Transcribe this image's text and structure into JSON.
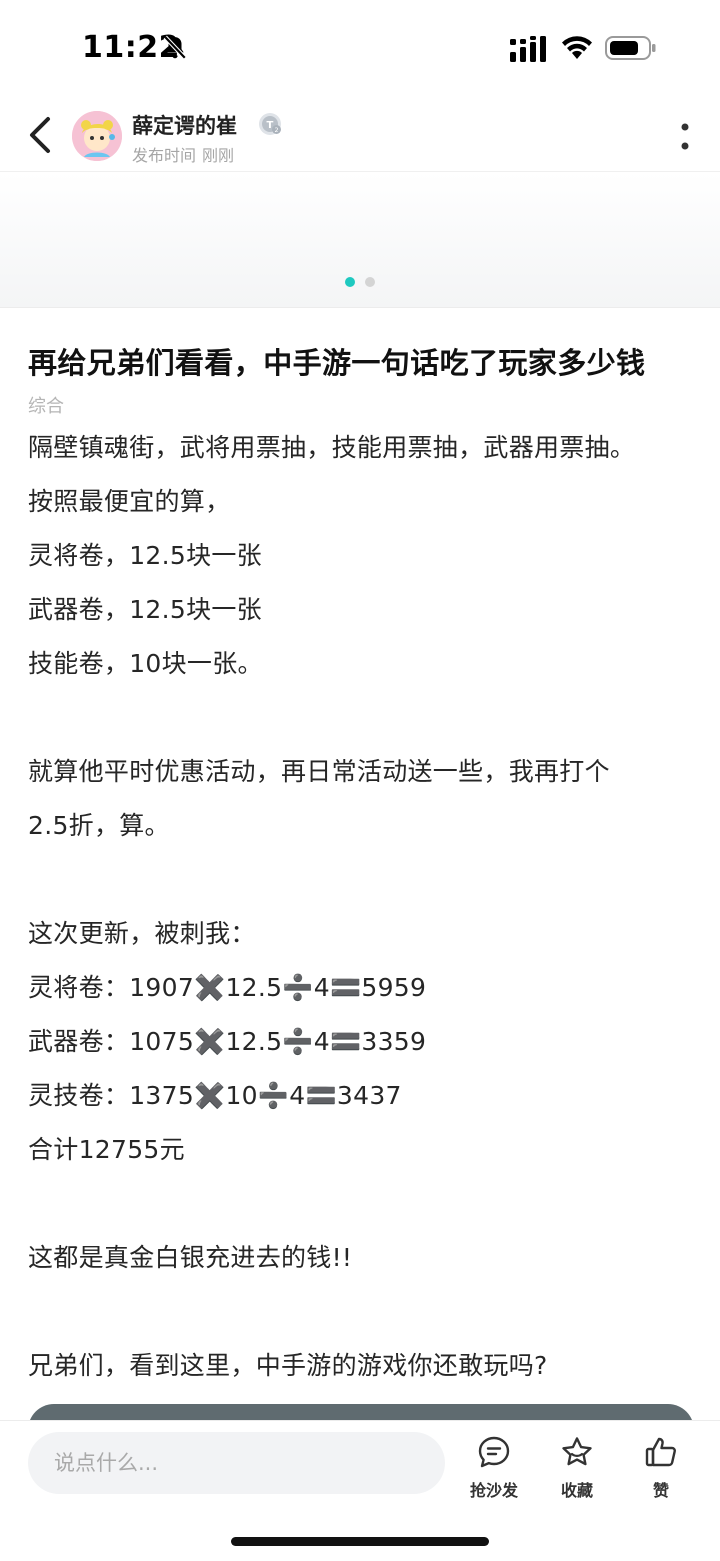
{
  "status_bar": {
    "time": "11:22",
    "icons": [
      "bell-mute-icon",
      "cellular-signal-icon",
      "wifi-icon",
      "battery-icon"
    ]
  },
  "header": {
    "author_name": "薛定谔的崔",
    "level_badge": "T2",
    "publish_label": "发布时间",
    "publish_time": "刚刚",
    "icons": [
      "back-arrow-icon",
      "more-vertical-icon"
    ]
  },
  "gallery": {
    "dots_total": 2,
    "active_index": 0,
    "accent_color": "#1fc9c0"
  },
  "post": {
    "title": "再给兄弟们看看，中手游一句话吃了玩家多少钱",
    "category": "综合",
    "lines": [
      "隔壁镇魂街，武将用票抽，技能用票抽，武器用票抽。",
      "按照最便宜的算，",
      "灵将卷，12.5块一张",
      "武器卷，12.5块一张",
      "技能卷，10块一张。",
      "",
      "就算他平时优惠活动，再日常活动送一些，我再打个",
      "2.5折，算。",
      "",
      "这次更新，被刺我：",
      "灵将卷：1907✖️12.5➗4🟰5959",
      "武器卷：1075✖️12.5➗4🟰3359",
      "灵技卷：1375✖️10➗4🟰3437",
      "合计12755元",
      "",
      "这都是真金白银充进去的钱!!",
      "",
      "兄弟们，看到这里，中手游的游戏你还敢玩吗?"
    ]
  },
  "bottom_bar": {
    "comment_placeholder": "说点什么...",
    "sofa_label": "抢沙发",
    "favorite_label": "收藏",
    "like_label": "赞"
  }
}
